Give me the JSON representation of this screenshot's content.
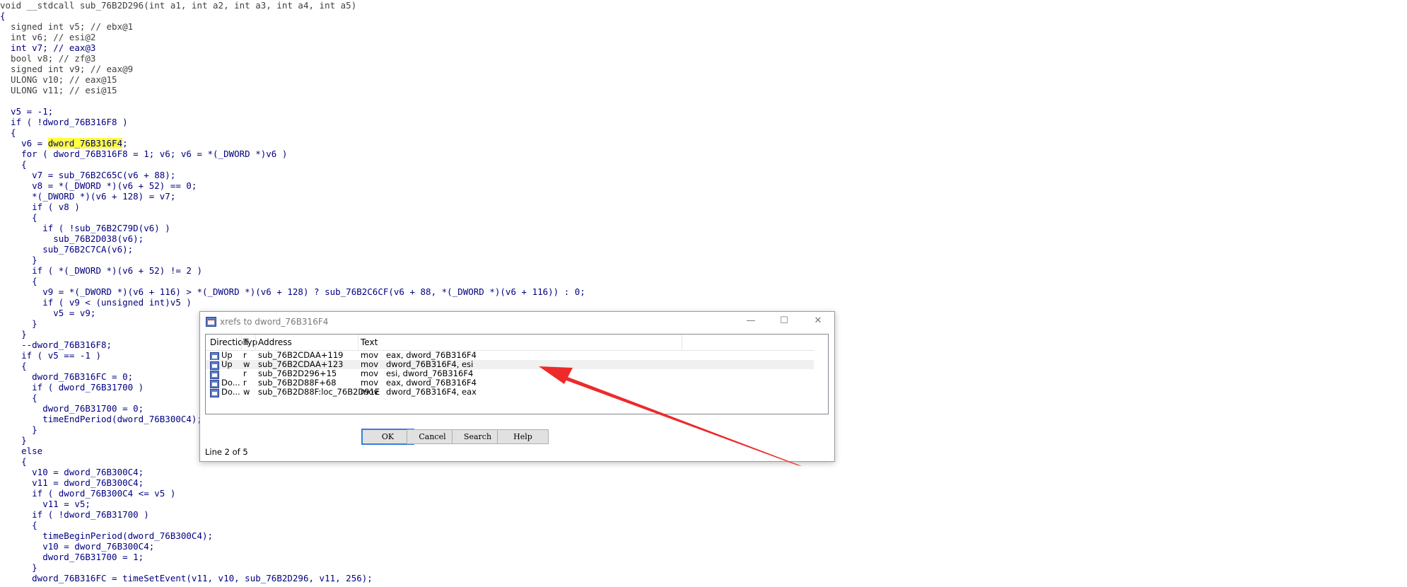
{
  "code_lines": [
    {
      "text": "void __stdcall sub_76B2D296(int a1, int a2, int a3, int a4, int a5)",
      "color": "#404040"
    },
    {
      "text": "{",
      "color": "#000080"
    },
    {
      "text": "  signed int v5; // ebx@1",
      "color": "#404040"
    },
    {
      "text": "  int v6; // esi@2",
      "color": "#404040"
    },
    {
      "text": "  int v7; // eax@3",
      "color": "#000080"
    },
    {
      "text": "  bool v8; // zf@3",
      "color": "#404040"
    },
    {
      "text": "  signed int v9; // eax@9",
      "color": "#404040"
    },
    {
      "text": "  ULONG v10; // eax@15",
      "color": "#404040"
    },
    {
      "text": "  ULONG v11; // esi@15",
      "color": "#404040"
    },
    {
      "text": "",
      "color": "#000080"
    },
    {
      "text": "  v5 = -1;",
      "color": "#000080"
    },
    {
      "text": "  if ( !dword_76B316F8 )",
      "color": "#000080"
    },
    {
      "text": "  {",
      "color": "#000080"
    },
    {
      "text": "    v6 = dword_76B316F4;",
      "color": "#000080"
    },
    {
      "text": "    for ( dword_76B316F8 = 1; v6; v6 = *(_DWORD *)v6 )",
      "color": "#000080"
    },
    {
      "text": "    {",
      "color": "#000080"
    },
    {
      "text": "      v7 = sub_76B2C65C(v6 + 88);",
      "color": "#000080"
    },
    {
      "text": "      v8 = *(_DWORD *)(v6 + 52) == 0;",
      "color": "#000080"
    },
    {
      "text": "      *(_DWORD *)(v6 + 128) = v7;",
      "color": "#000080"
    },
    {
      "text": "      if ( v8 )",
      "color": "#000080"
    },
    {
      "text": "      {",
      "color": "#000080"
    },
    {
      "text": "        if ( !sub_76B2C79D(v6) )",
      "color": "#000080"
    },
    {
      "text": "          sub_76B2D038(v6);",
      "color": "#000080"
    },
    {
      "text": "        sub_76B2C7CA(v6);",
      "color": "#000080"
    },
    {
      "text": "      }",
      "color": "#000080"
    },
    {
      "text": "      if ( *(_DWORD *)(v6 + 52) != 2 )",
      "color": "#000080"
    },
    {
      "text": "      {",
      "color": "#000080"
    },
    {
      "text": "        v9 = *(_DWORD *)(v6 + 116) > *(_DWORD *)(v6 + 128) ? sub_76B2C6CF(v6 + 88, *(_DWORD *)(v6 + 116)) : 0;",
      "color": "#000080"
    },
    {
      "text": "        if ( v9 < (unsigned int)v5 )",
      "color": "#000080"
    },
    {
      "text": "          v5 = v9;",
      "color": "#000080"
    },
    {
      "text": "      }",
      "color": "#000080"
    },
    {
      "text": "    }",
      "color": "#000080"
    },
    {
      "text": "    --dword_76B316F8;",
      "color": "#000080"
    },
    {
      "text": "    if ( v5 == -1 )",
      "color": "#000080"
    },
    {
      "text": "    {",
      "color": "#000080"
    },
    {
      "text": "      dword_76B316FC = 0;",
      "color": "#000080"
    },
    {
      "text": "      if ( dword_76B31700 )",
      "color": "#000080"
    },
    {
      "text": "      {",
      "color": "#000080"
    },
    {
      "text": "        dword_76B31700 = 0;",
      "color": "#000080"
    },
    {
      "text": "        timeEndPeriod(dword_76B300C4);",
      "color": "#000080"
    },
    {
      "text": "      }",
      "color": "#000080"
    },
    {
      "text": "    }",
      "color": "#000080"
    },
    {
      "text": "    else",
      "color": "#000080"
    },
    {
      "text": "    {",
      "color": "#000080"
    },
    {
      "text": "      v10 = dword_76B300C4;",
      "color": "#000080"
    },
    {
      "text": "      v11 = dword_76B300C4;",
      "color": "#000080"
    },
    {
      "text": "      if ( dword_76B300C4 <= v5 )",
      "color": "#000080"
    },
    {
      "text": "        v11 = v5;",
      "color": "#000080"
    },
    {
      "text": "      if ( !dword_76B31700 )",
      "color": "#000080"
    },
    {
      "text": "      {",
      "color": "#000080"
    },
    {
      "text": "        timeBeginPeriod(dword_76B300C4);",
      "color": "#000080"
    },
    {
      "text": "        v10 = dword_76B300C4;",
      "color": "#000080"
    },
    {
      "text": "        dword_76B31700 = 1;",
      "color": "#000080"
    },
    {
      "text": "      }",
      "color": "#000080"
    },
    {
      "text": "      dword_76B316FC = timeSetEvent(v11, v10, sub_76B2D296, v11, 256);",
      "color": "#000080"
    }
  ],
  "highlight": {
    "line_index": 13,
    "token": "dword_76B316F4",
    "color": "#ffff40"
  },
  "dialog": {
    "title": "xrefs to dword_76B316F4",
    "window_buttons": {
      "minimize": "—",
      "maximize": "☐",
      "close": "✕"
    },
    "columns": [
      "Direction",
      "Typ",
      "Address",
      "Text"
    ],
    "rows": [
      {
        "direction": "Up",
        "type": "r",
        "address": "sub_76B2CDAA+119",
        "mnemonic": "mov",
        "operands": "eax, dword_76B316F4",
        "selected": false
      },
      {
        "direction": "Up",
        "type": "w",
        "address": "sub_76B2CDAA+123",
        "mnemonic": "mov",
        "operands": "dword_76B316F4, esi",
        "selected": true
      },
      {
        "direction": "",
        "type": "r",
        "address": "sub_76B2D296+15",
        "mnemonic": "mov",
        "operands": "esi, dword_76B316F4",
        "selected": false
      },
      {
        "direction": "Do...",
        "type": "r",
        "address": "sub_76B2D88F+68",
        "mnemonic": "mov",
        "operands": "eax, dword_76B316F4",
        "selected": false
      },
      {
        "direction": "Do...",
        "type": "w",
        "address": "sub_76B2D88F:loc_76B2D91E",
        "mnemonic": "mov",
        "operands": "dword_76B316F4, eax",
        "selected": false
      }
    ],
    "buttons": {
      "ok": "OK",
      "cancel": "Cancel",
      "search": "Search",
      "help": "Help"
    },
    "status": "Line 2 of 5"
  },
  "annotation_color": "#ee2a2a"
}
